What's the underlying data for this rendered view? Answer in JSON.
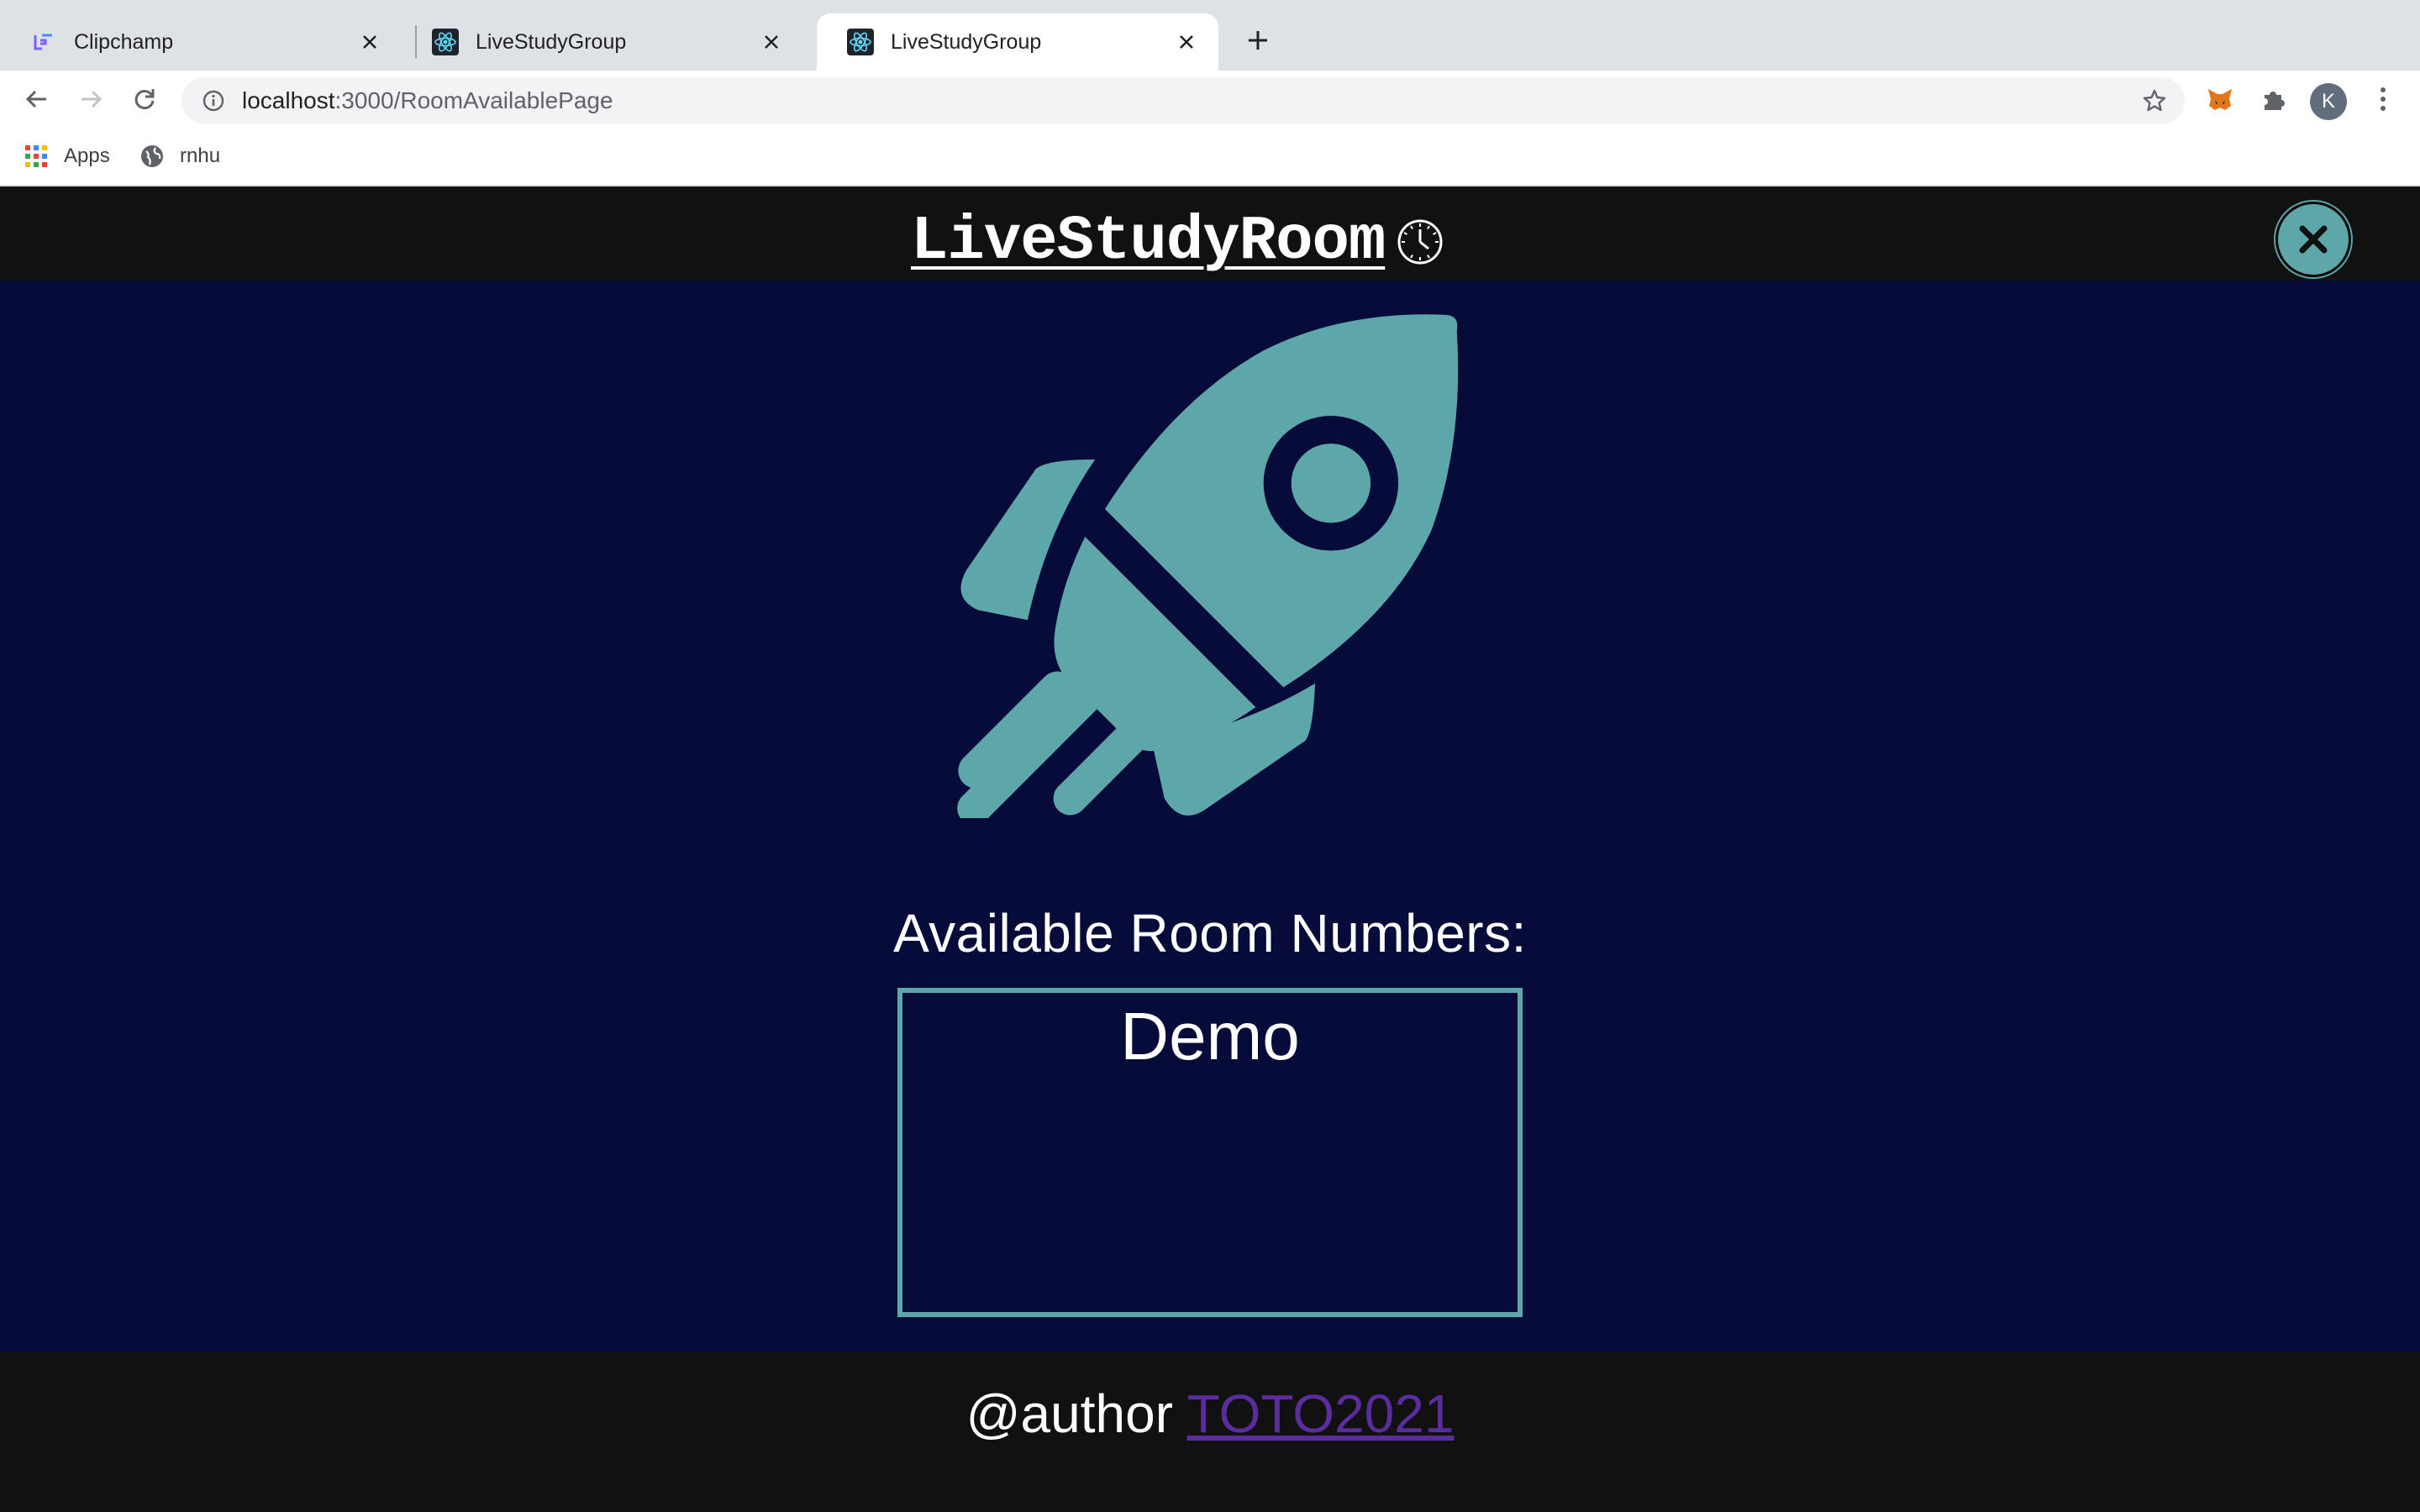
{
  "browser": {
    "tabs": [
      {
        "title": "Clipchamp",
        "icon": "clipchamp-icon",
        "active": false
      },
      {
        "title": "LiveStudyGroup",
        "icon": "react-icon",
        "active": false
      },
      {
        "title": "LiveStudyGroup",
        "icon": "react-icon",
        "active": true
      }
    ],
    "url_host": "localhost",
    "url_path": ":3000/RoomAvailablePage",
    "profile_initial": "K",
    "bookmarks": [
      {
        "label": "Apps",
        "icon": "apps-grid-icon"
      },
      {
        "label": "rnhu",
        "icon": "globe-icon"
      }
    ]
  },
  "header": {
    "title": "LiveStudyRoom",
    "clock_icon": "clock-icon",
    "close_icon": "close-icon"
  },
  "main": {
    "hero_icon": "rocket-icon",
    "rooms_label": "Available Room Numbers:",
    "rooms": [
      "Demo"
    ]
  },
  "footer": {
    "prefix": "@author",
    "author_link": "TOTO2021"
  },
  "colors": {
    "page_bg": "#060b3a",
    "bar_bg": "#111111",
    "accent": "#5ea7a9",
    "link": "#5b2c9d"
  }
}
